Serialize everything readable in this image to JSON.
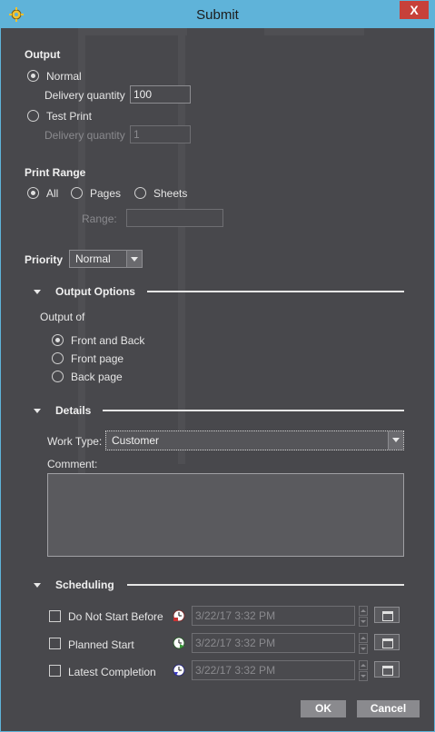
{
  "window": {
    "title": "Submit",
    "close_label": "X"
  },
  "output": {
    "title": "Output",
    "normal_label": "Normal",
    "normal_qty_label": "Delivery quantity",
    "normal_qty_value": "100",
    "testprint_label": "Test Print",
    "testprint_qty_label": "Delivery quantity",
    "testprint_qty_value": "1"
  },
  "print_range": {
    "title": "Print Range",
    "all_label": "All",
    "pages_label": "Pages",
    "sheets_label": "Sheets",
    "range_label": "Range:",
    "range_value": ""
  },
  "priority": {
    "label": "Priority",
    "value": "Normal"
  },
  "output_options": {
    "title": "Output Options",
    "output_of_label": "Output of",
    "options": [
      "Front and Back",
      "Front page",
      "Back page"
    ]
  },
  "details": {
    "title": "Details",
    "work_type_label": "Work Type:",
    "work_type_value": "Customer",
    "comment_label": "Comment:",
    "comment_value": ""
  },
  "scheduling": {
    "title": "Scheduling",
    "rows": [
      {
        "label": "Do Not Start Before",
        "value": "3/22/17 3:32 PM"
      },
      {
        "label": "Planned Start",
        "value": "3/22/17 3:32 PM"
      },
      {
        "label": "Latest Completion",
        "value": "3/22/17 3:32 PM"
      }
    ]
  },
  "buttons": {
    "ok": "OK",
    "cancel": "Cancel"
  },
  "colors": {
    "titlebar": "#5fb3d9",
    "close": "#c7413a",
    "background": "#48484c"
  }
}
